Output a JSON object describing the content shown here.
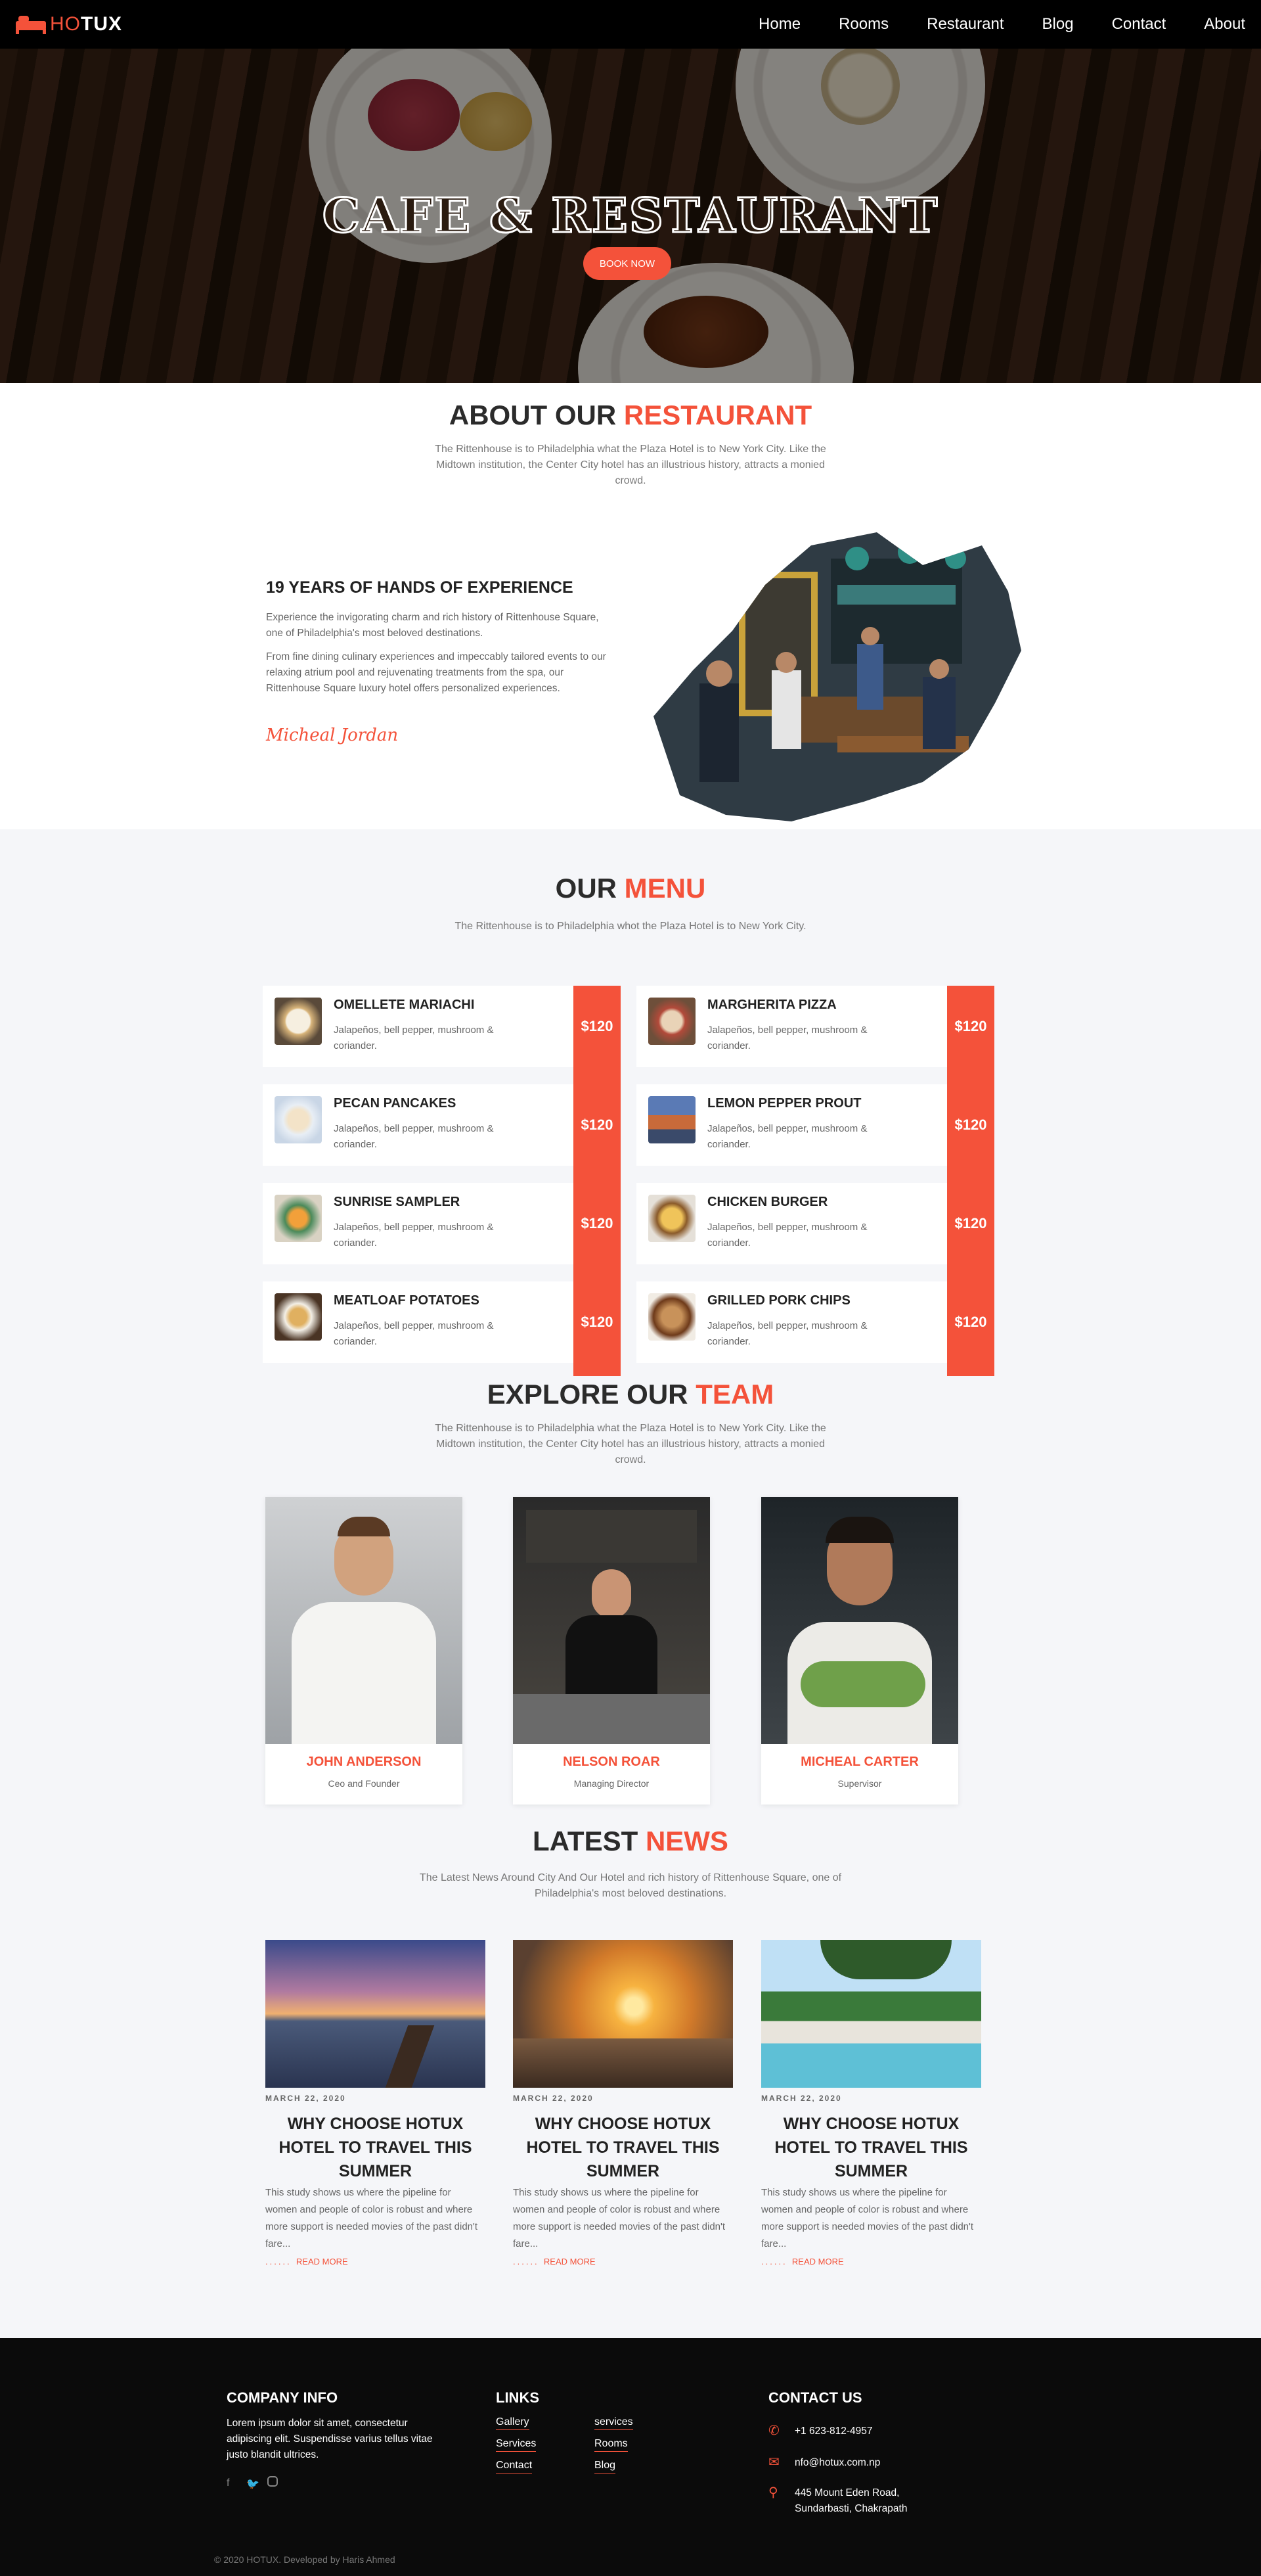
{
  "brand": {
    "part1": "HO",
    "part2": "TUX",
    "accent": "#f4523a"
  },
  "nav": [
    "Home",
    "Rooms",
    "Restaurant",
    "Blog",
    "Contact",
    "About"
  ],
  "hero": {
    "title": "CAFE & RESTAURANT",
    "button": "BOOK NOW"
  },
  "about": {
    "title_plain": "ABOUT OUR",
    "title_accent": "RESTAURANT",
    "intro": "The Rittenhouse is to Philadelphia what the Plaza Hotel is to New York City. Like the Midtown institution, the Center City hotel has an illustrious history, attracts a monied crowd.",
    "heading": "19 YEARS OF HANDS OF EXPERIENCE",
    "para1": "Experience the invigorating charm and rich history of Rittenhouse Square, one of Philadelphia's most beloved destinations.",
    "para2": "From fine dining culinary experiences and impeccably tailored events to our relaxing atrium pool and rejuvenating treatments from the spa, our Rittenhouse Square luxury hotel offers personalized experiences.",
    "signature": "Micheal Jordan"
  },
  "menu": {
    "title_plain": "OUR",
    "title_accent": "MENU",
    "subtitle": "The Rittenhouse is to Philadelphia whot the Plaza Hotel is to New York City.",
    "items": [
      {
        "name": "OMELLETE MARIACHI",
        "desc": "Jalapeños, bell pepper, mushroom & coriander.",
        "price": "$120"
      },
      {
        "name": "MARGHERITA PIZZA",
        "desc": "Jalapeños, bell pepper, mushroom & coriander.",
        "price": "$120"
      },
      {
        "name": "PECAN PANCAKES",
        "desc": "Jalapeños, bell pepper, mushroom & coriander.",
        "price": "$120"
      },
      {
        "name": "LEMON PEPPER PROUT",
        "desc": "Jalapeños, bell pepper, mushroom & coriander.",
        "price": "$120"
      },
      {
        "name": "SUNRISE SAMPLER",
        "desc": "Jalapeños, bell pepper, mushroom & coriander.",
        "price": "$120"
      },
      {
        "name": "CHICKEN BURGER",
        "desc": "Jalapeños, bell pepper, mushroom & coriander.",
        "price": "$120"
      },
      {
        "name": "MEATLOAF POTATOES",
        "desc": "Jalapeños, bell pepper, mushroom & coriander.",
        "price": "$120"
      },
      {
        "name": "GRILLED PORK CHIPS",
        "desc": "Jalapeños, bell pepper, mushroom & coriander.",
        "price": "$120"
      }
    ]
  },
  "team": {
    "title_plain": "EXPLORE OUR",
    "title_accent": "TEAM",
    "subtitle": "The Rittenhouse is to Philadelphia what the Plaza Hotel is to New York City. Like the Midtown institution, the Center City hotel has an illustrious history, attracts a monied crowd.",
    "members": [
      {
        "name": "JOHN ANDERSON",
        "role": "Ceo and Founder"
      },
      {
        "name": "NELSON ROAR",
        "role": "Managing Director"
      },
      {
        "name": "MICHEAL CARTER",
        "role": "Supervisor"
      }
    ]
  },
  "news": {
    "title_plain": "LATEST",
    "title_accent": "NEWS",
    "subtitle": "The Latest News Around City And Our Hotel and rich history of Rittenhouse Square, one of Philadelphia's most beloved destinations.",
    "posts": [
      {
        "date": "MARCH 22, 2020",
        "title": "WHY CHOOSE HOTUX HOTEL TO TRAVEL THIS SUMMER",
        "text": "This study shows us where the pipeline for women and people of color is robust and where more support is needed movies of the past didn't fare...",
        "dots": "......",
        "more": "READ MORE"
      },
      {
        "date": "MARCH 22, 2020",
        "title": "WHY CHOOSE HOTUX HOTEL TO TRAVEL THIS SUMMER",
        "text": "This study shows us where the pipeline for women and people of color is robust and where more support is needed movies of the past didn't fare...",
        "dots": "......",
        "more": "READ MORE"
      },
      {
        "date": "MARCH 22, 2020",
        "title": "WHY CHOOSE HOTUX HOTEL TO TRAVEL THIS SUMMER",
        "text": "This study shows us where the pipeline for women and people of color is robust and where more support is needed movies of the past didn't fare...",
        "dots": "......",
        "more": "READ MORE"
      }
    ]
  },
  "footer": {
    "company_title": "COMPANY INFO",
    "company_text": "Lorem ipsum dolor sit amet, consectetur adipiscing elit. Suspendisse varius tellus vitae justo blandit ultrices.",
    "social": [
      "facebook-icon",
      "twitter-icon",
      "instagram-icon"
    ],
    "links_title": "LINKS",
    "links_col1": [
      "Gallery",
      "Services",
      "Contact"
    ],
    "links_col2": [
      "services",
      "Rooms",
      "Blog"
    ],
    "contact_title": "CONTACT US",
    "phone": "+1 623-812-4957",
    "email": "nfo@hotux.com.np",
    "address": "445 Mount Eden Road, Sundarbasti, Chakrapath",
    "copyright": "© 2020 HOTUX. Developed by Haris Ahmed"
  }
}
